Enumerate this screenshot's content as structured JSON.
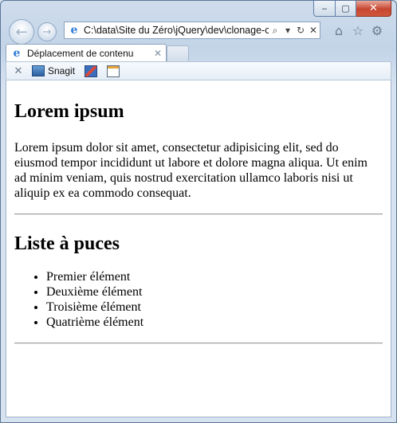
{
  "window": {
    "caption": {
      "minimize": "‒",
      "maximize": "▢",
      "close": "✕"
    }
  },
  "nav": {
    "back": "←",
    "forward": "→",
    "address_url": "C:\\data\\Site du Zéro\\jQuery\\dev\\clonage-c",
    "icons": [
      "search-icon",
      "dropdown-icon",
      "refresh-icon",
      "stop-icon",
      "home-icon",
      "favorites-icon",
      "tools-icon"
    ]
  },
  "tab": {
    "title": "Déplacement de contenu",
    "close": "✕"
  },
  "command_bar": {
    "close": "✕",
    "snagit_label": "Snagit"
  },
  "page": {
    "heading1": "Lorem ipsum",
    "paragraph": "Lorem ipsum dolor sit amet, consectetur adipisicing elit, sed do eiusmod tempor incididunt ut labore et dolore magna aliqua. Ut enim ad minim veniam, quis nostrud exercitation ullamco laboris nisi ut aliquip ex ea commodo consequat.",
    "heading2": "Liste à puces",
    "list": [
      "Premier élément",
      "Deuxième élément",
      "Troisième élément",
      "Quatrième élément"
    ]
  }
}
